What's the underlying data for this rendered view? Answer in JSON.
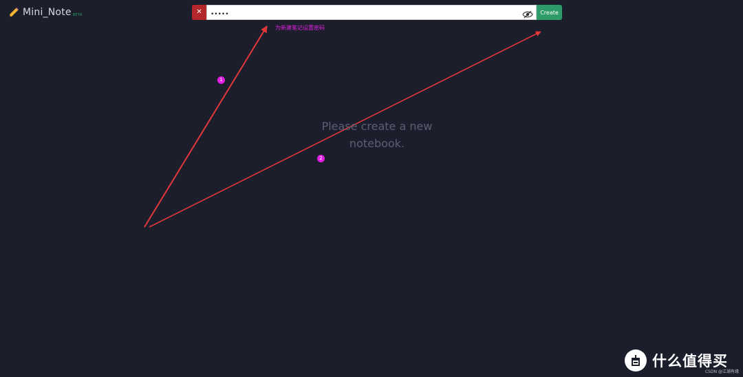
{
  "app": {
    "name": "Mini_Note",
    "badge": "BETA"
  },
  "toolbar": {
    "cancel_label": "✕",
    "password_value": "•••••",
    "create_label": "Create"
  },
  "annotation": {
    "hint_text": "为新建笔记设置密码",
    "step1": "1",
    "step2": "2"
  },
  "empty_state": {
    "line1": "Please create a new",
    "line2": "notebook."
  },
  "watermark": {
    "brand": "什么值得买",
    "credit": "CSDN @江湖有缘"
  },
  "colors": {
    "background": "#1c1f2b",
    "cancel": "#b3272b",
    "create": "#2e9c68",
    "annotation": "#e01fe0",
    "arrow": "#e3373b"
  }
}
